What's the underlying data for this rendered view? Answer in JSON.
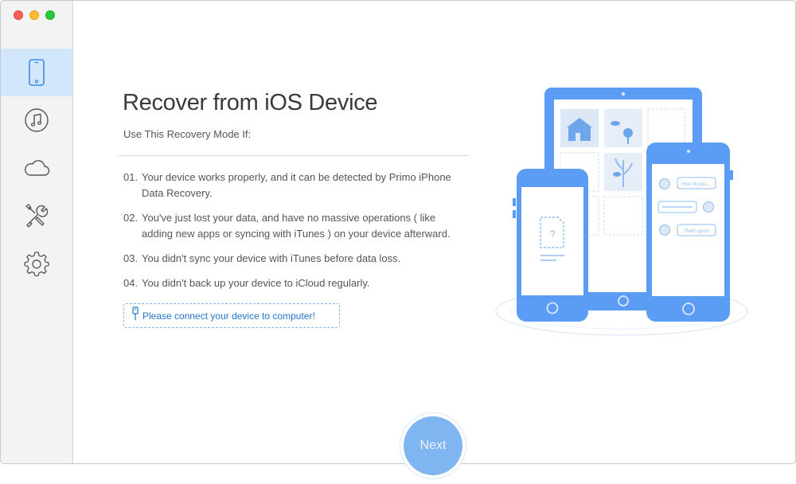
{
  "window": {
    "title": ""
  },
  "sidebar": {
    "items": [
      {
        "icon": "iphone-icon",
        "active": true
      },
      {
        "icon": "music-icon",
        "active": false
      },
      {
        "icon": "cloud-icon",
        "active": false
      },
      {
        "icon": "tools-icon",
        "active": false
      },
      {
        "icon": "gear-icon",
        "active": false
      }
    ]
  },
  "main": {
    "title": "Recover from iOS Device",
    "subtitle": "Use This Recovery Mode If:",
    "steps": [
      {
        "num": "01.",
        "text": "Your device works properly, and it can be detected by Primo iPhone Data Recovery."
      },
      {
        "num": "02.",
        "text": "You've just lost your data, and have no massive operations ( like adding new apps or syncing with iTunes ) on your device afterward."
      },
      {
        "num": "03.",
        "text": "You didn't sync your device with iTunes before data loss."
      },
      {
        "num": "04.",
        "text": "You didn't back up your device to iCloud regularly."
      }
    ],
    "connect_prompt": "Please connect your device to computer!",
    "next_label": "Next"
  },
  "illustration": {
    "chat_bubbles": [
      "How do you...",
      "That's good"
    ],
    "question_mark": "?"
  },
  "colors": {
    "accent": "#5b9cf5",
    "accent_light": "#d2e7fb",
    "link": "#2474c9"
  }
}
